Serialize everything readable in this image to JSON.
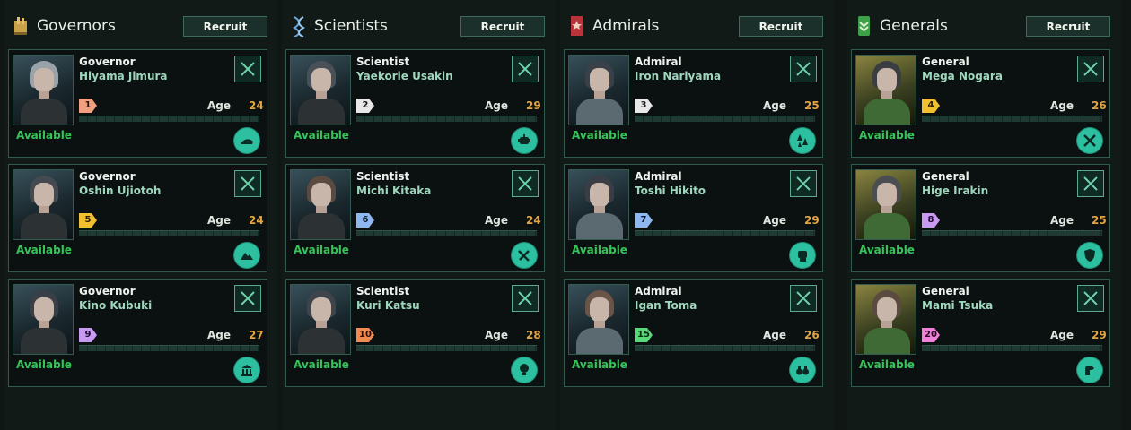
{
  "columns": [
    {
      "title": "Governors",
      "icon": "governor-icon",
      "recruit_label": "Recruit",
      "leaders": [
        {
          "role": "Governor",
          "name": "Hiyama Jimura",
          "level": "1",
          "age_label": "Age",
          "age": "24",
          "status": "Available",
          "trait_icon": "hat-icon"
        },
        {
          "role": "Governor",
          "name": "Oshin Ujiotoh",
          "level": "5",
          "age_label": "Age",
          "age": "24",
          "status": "Available",
          "trait_icon": "mountain-icon"
        },
        {
          "role": "Governor",
          "name": "Kino Kubuki",
          "level": "9",
          "age_label": "Age",
          "age": "27",
          "status": "Available",
          "trait_icon": "building-icon"
        }
      ]
    },
    {
      "title": "Scientists",
      "icon": "dna-icon",
      "recruit_label": "Recruit",
      "leaders": [
        {
          "role": "Scientist",
          "name": "Yaekorie Usakin",
          "level": "2",
          "age_label": "Age",
          "age": "29",
          "status": "Available",
          "trait_icon": "robot-icon"
        },
        {
          "role": "Scientist",
          "name": "Michi Kitaka",
          "level": "6",
          "age_label": "Age",
          "age": "24",
          "status": "Available",
          "trait_icon": "tools-icon"
        },
        {
          "role": "Scientist",
          "name": "Kuri Katsu",
          "level": "10",
          "age_label": "Age",
          "age": "28",
          "status": "Available",
          "trait_icon": "lightbulb-icon"
        }
      ]
    },
    {
      "title": "Admirals",
      "icon": "admiral-flag-icon",
      "recruit_label": "Recruit",
      "leaders": [
        {
          "role": "Admiral",
          "name": "Iron Nariyama",
          "level": "3",
          "age_label": "Age",
          "age": "25",
          "status": "Available",
          "trait_icon": "fleet-icon"
        },
        {
          "role": "Admiral",
          "name": "Toshi Hikito",
          "level": "7",
          "age_label": "Age",
          "age": "29",
          "status": "Available",
          "trait_icon": "fist-icon"
        },
        {
          "role": "Admiral",
          "name": "Igan Toma",
          "level": "15",
          "age_label": "Age",
          "age": "26",
          "status": "Available",
          "trait_icon": "binoculars-icon"
        }
      ]
    },
    {
      "title": "Generals",
      "icon": "general-badge-icon",
      "recruit_label": "Recruit",
      "leaders": [
        {
          "role": "General",
          "name": "Mega Nogara",
          "level": "4",
          "age_label": "Age",
          "age": "26",
          "status": "Available",
          "trait_icon": "crossed-swords-icon"
        },
        {
          "role": "General",
          "name": "Hige Irakin",
          "level": "8",
          "age_label": "Age",
          "age": "25",
          "status": "Available",
          "trait_icon": "shield-icon"
        },
        {
          "role": "General",
          "name": "Mami Tsuka",
          "level": "20",
          "age_label": "Age",
          "age": "29",
          "status": "Available",
          "trait_icon": "beast-icon"
        }
      ]
    }
  ],
  "colors": {
    "level_1": "#f0a080",
    "level_2": "#e8e8e8",
    "level_3": "#e8e8e8",
    "level_4": "#f0c030",
    "level_5": "#f0c030",
    "level_6": "#8fb8f0",
    "level_7": "#8fb8f0",
    "level_8": "#c89af0",
    "level_9": "#c89af0",
    "level_10": "#f08a50",
    "level_15": "#58d878",
    "level_20": "#f080d8",
    "trait_badge": "#2cbfa0",
    "available": "#36c45a",
    "age_value": "#e0a446"
  }
}
